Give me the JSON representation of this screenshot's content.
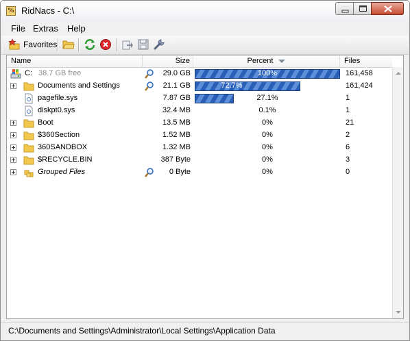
{
  "window": {
    "title": "RidNacs - C:\\"
  },
  "menu": {
    "items": [
      "File",
      "Extras",
      "Help"
    ]
  },
  "toolbar": {
    "favorites_label": "Favorites",
    "icons": [
      "favorites-star-folder-icon",
      "open-folder-icon",
      "refresh-icon",
      "stop-icon",
      "export-icon",
      "save-icon",
      "settings-wrench-icon"
    ]
  },
  "columns": {
    "name": "Name",
    "size": "Size",
    "percent": "Percent",
    "files": "Files"
  },
  "drive": {
    "name": "C:",
    "free": "38.7 GB free",
    "size": "29.0 GB",
    "percent": "100%",
    "files": "161,458"
  },
  "rows": [
    {
      "name": "Documents and Settings",
      "size": "21.1 GB",
      "percent": "72.7%",
      "files": "161,424",
      "icon": "folder-icon",
      "percent_value": 72.7
    },
    {
      "name": "pagefile.sys",
      "size": "7.87 GB",
      "percent": "27.1%",
      "files": "1",
      "icon": "file-icon",
      "percent_value": 27.1
    },
    {
      "name": "diskpt0.sys",
      "size": "32.4 MB",
      "percent": "0.1%",
      "files": "1",
      "icon": "file-icon",
      "percent_value": 0.1
    },
    {
      "name": "Boot",
      "size": "13.5 MB",
      "percent": "0%",
      "files": "21",
      "icon": "folder-icon",
      "percent_value": 0
    },
    {
      "name": "$360Section",
      "size": "1.52 MB",
      "percent": "0%",
      "files": "2",
      "icon": "folder-icon",
      "percent_value": 0
    },
    {
      "name": "360SANDBOX",
      "size": "1.32 MB",
      "percent": "0%",
      "files": "6",
      "icon": "folder-icon",
      "percent_value": 0
    },
    {
      "name": "$RECYCLE.BIN",
      "size": "387 Byte",
      "percent": "0%",
      "files": "3",
      "icon": "folder-icon",
      "percent_value": 0
    },
    {
      "name": "Grouped Files",
      "size": "0 Byte",
      "percent": "0%",
      "files": "0",
      "icon": "grouped-files-icon",
      "percent_value": 0
    }
  ],
  "status": {
    "path": "C:\\Documents and Settings\\Administrator\\Local Settings\\Application Data"
  },
  "colors": {
    "bar_dark": "#2a5fb8",
    "bar_light": "#5d8fd9",
    "folder": "#f2c94c"
  }
}
